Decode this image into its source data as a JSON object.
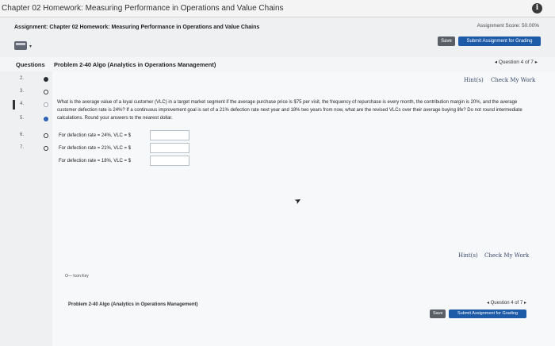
{
  "window": {
    "title": "Chapter 02 Homework: Measuring Performance in Operations and Value Chains"
  },
  "assignment": {
    "title": "Assignment: Chapter 02 Homework: Measuring Performance in Operations and Value Chains",
    "score": "Assignment Score: 50.00%",
    "save_label": "Save",
    "submit_label": "Submit Assignment for Grading"
  },
  "questions": {
    "label": "Questions",
    "problem_title": "Problem 2-40 Algo (Analytics in Operations Management)",
    "nav": "◂ Question 4 of 7 ▸",
    "items": [
      {
        "num": "2.",
        "status": "filled"
      },
      {
        "num": "3.",
        "status": "ring"
      },
      {
        "num": "4.",
        "status": "open"
      },
      {
        "num": "5.",
        "status": "blue"
      },
      {
        "num": "6.",
        "status": "ring"
      },
      {
        "num": "7.",
        "status": "ring"
      }
    ]
  },
  "problem": {
    "hint_label": "Hint(s)",
    "check_label": "Check My Work",
    "text": "What is the average value of a loyal customer (VLC) in a target market segment if the average purchase price is $75 per visit, the frequency of repurchase is every month, the contribution margin is 20%, and the average customer defection rate is 24%? If a continuous improvement goal is set of a 21% defection rate next year and 18% two years from now, what are the revised VLCs over their average buying life? Do not round intermediate calculations. Round your answers to the nearest dollar.",
    "answers": [
      {
        "label": "For defection rate = 24%, VLC = $",
        "value": ""
      },
      {
        "label": "For defection rate = 21%, VLC = $",
        "value": ""
      },
      {
        "label": "For defection rate = 18%, VLC = $",
        "value": ""
      }
    ],
    "icon_key": "O— Icon Key"
  },
  "footer": {
    "hint_label": "Hint(s)",
    "check_label": "Check My Work",
    "problem_title": "Problem 2-40 Algo (Analytics in Operations Management)",
    "nav": "◂ Question 4 of 7 ▸",
    "save_label": "Save",
    "submit_label": "Submit Assignment for Grading"
  },
  "colors": {
    "accent": "#1d5aa8",
    "save": "#5a5f66"
  }
}
